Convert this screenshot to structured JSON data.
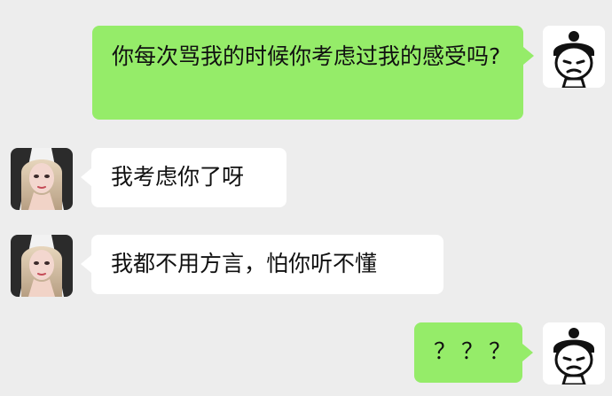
{
  "messages": [
    {
      "id": "m1",
      "side": "right",
      "text": "你每次骂我的时候你考虑过我的感受吗?"
    },
    {
      "id": "m2",
      "side": "left",
      "text": "我考虑你了呀"
    },
    {
      "id": "m3",
      "side": "left",
      "text": "我都不用方言，怕你听不懂"
    },
    {
      "id": "m4",
      "side": "right",
      "text": "？？？"
    }
  ],
  "avatars": {
    "self_icon": "cartoon-face-avatar",
    "other_icon": "woman-portrait-avatar"
  },
  "colors": {
    "background": "#ededed",
    "self_bubble": "#95ec69",
    "other_bubble": "#ffffff"
  }
}
